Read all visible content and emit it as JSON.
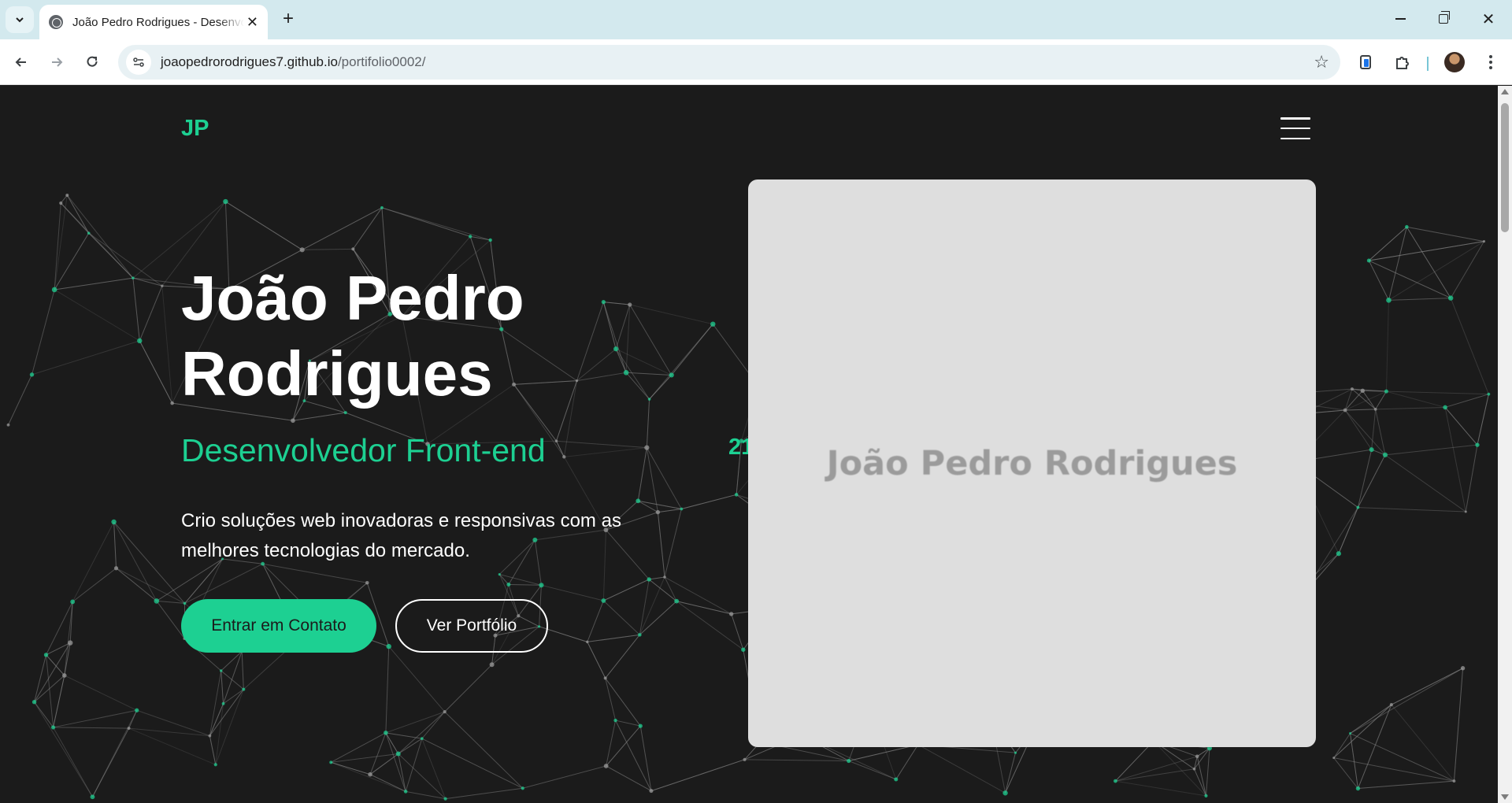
{
  "browser": {
    "tab_title": "João Pedro Rodrigues - Desenvolvedor Front-end",
    "url_host": "joaopedrorodrigues7.github.io",
    "url_path": "/portifolio0002/"
  },
  "header": {
    "logo": "JP"
  },
  "hero": {
    "title_line1": "João Pedro",
    "title_line2": "Rodrigues",
    "subtitle": "Desenvolvedor Front-end",
    "description": "Crio soluções web inovadoras e responsivas com as melhores tecnologias do mercado.",
    "primary_button": "Entrar em Contato",
    "secondary_button": "Ver Portfólio",
    "partial_text": "21",
    "photo_placeholder": "João Pedro Rodrigues"
  },
  "colors": {
    "accent": "#1dd092",
    "background": "#1b1b1b",
    "photo_bg": "#dedede",
    "browser_frame": "#d3e9ee"
  }
}
